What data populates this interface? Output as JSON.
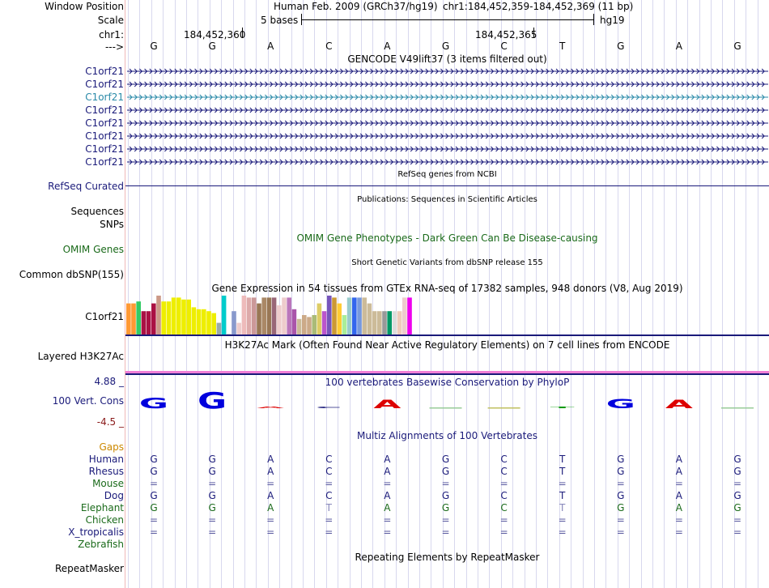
{
  "header": {
    "window_position_label": "Window Position",
    "assembly_text": "Human Feb. 2009 (GRCh37/hg19)",
    "position_text": "chr1:184,452,359-184,452,369 (11 bp)",
    "scale_label": "Scale",
    "scale_text": "5 bases",
    "db": "hg19",
    "chrom_label": "chr1:",
    "coord1": "184,452,360",
    "coord2": "184,452,365",
    "arrow_label": "--->"
  },
  "sequence": [
    "G",
    "G",
    "A",
    "C",
    "A",
    "G",
    "C",
    "T",
    "G",
    "A",
    "G"
  ],
  "gencode": {
    "title": "GENCODE V49lift37 (3 items filtered out)",
    "items": [
      {
        "label": "C1orf21",
        "color": "#1a1a7a"
      },
      {
        "label": "C1orf21",
        "color": "#1a1a7a"
      },
      {
        "label": "C1orf21",
        "color": "#2a8aa8"
      },
      {
        "label": "C1orf21",
        "color": "#1a1a7a"
      },
      {
        "label": "C1orf21",
        "color": "#1a1a7a"
      },
      {
        "label": "C1orf21",
        "color": "#1a1a7a"
      },
      {
        "label": "C1orf21",
        "color": "#1a1a7a"
      },
      {
        "label": "C1orf21",
        "color": "#1a1a7a"
      }
    ]
  },
  "refseq": {
    "center": "RefSeq genes from NCBI",
    "label": "RefSeq Curated"
  },
  "pubs": {
    "center": "Publications: Sequences in Scientific Articles"
  },
  "sequences_label": "Sequences",
  "snps_label": "SNPs",
  "omim": {
    "center": "OMIM Gene Phenotypes - Dark Green Can Be Disease-causing",
    "label": "OMIM Genes"
  },
  "dbsnp": {
    "center": "Short Genetic Variants from dbSNP release 155",
    "label": "Common dbSNP(155)"
  },
  "gtex": {
    "center": "Gene Expression in 54 tissues from GTEx RNA-seq of 17382 samples, 948 donors (V8, Aug 2019)",
    "label": "C1orf21",
    "values": [
      0.8,
      0.8,
      0.85,
      0.6,
      0.6,
      0.8,
      1.0,
      0.85,
      0.85,
      0.95,
      0.95,
      0.9,
      0.9,
      0.7,
      0.65,
      0.65,
      0.6,
      0.55,
      0.3,
      1.0,
      0.0,
      0.6,
      0.3,
      1.0,
      0.95,
      0.95,
      0.8,
      0.95,
      0.95,
      0.95,
      0.75,
      0.95,
      0.95,
      0.65,
      0.4,
      0.5,
      0.45,
      0.5,
      0.8,
      0.6,
      1.0,
      0.95,
      0.8,
      0.5,
      0.95,
      0.95,
      0.95,
      0.95,
      0.8,
      0.6,
      0.6,
      0.6,
      0.6,
      0.6,
      0.6,
      0.95,
      0.95,
      0.2
    ],
    "colors": [
      "#ff9933",
      "#ff9933",
      "#33cc66",
      "#aa1144",
      "#aa1144",
      "#aa1144",
      "#cc9988",
      "#eeee00",
      "#eeee00",
      "#eeee00",
      "#eeee00",
      "#eeee00",
      "#eeee00",
      "#eeee00",
      "#eeee00",
      "#eeee00",
      "#eeee00",
      "#eeee00",
      "#99aaaa",
      "#00cccc",
      "#cccccc",
      "#8899cc",
      "#eecccc",
      "#eebbbb",
      "#ddaaaa",
      "#cc9999",
      "#997755",
      "#aa8866",
      "#997755",
      "#996677",
      "#eecccc",
      "#eecccc",
      "#bb77bb",
      "#aa55aa",
      "#ccbb99",
      "#ccaa88",
      "#ccaa88",
      "#aabb77",
      "#ddcc66",
      "#bb55cc",
      "#7755bb",
      "#cc9933",
      "#ffcc33",
      "#aaee99",
      "#99cccc",
      "#3366ee",
      "#7799dd",
      "#ccbb99",
      "#ccbb99",
      "#ccbb99",
      "#ccbb99",
      "#999999",
      "#009966",
      "#dddddd",
      "#eeccbb",
      "#eecccc",
      "#ee00ee"
    ]
  },
  "h3k27ac": {
    "center": "H3K27Ac Mark (Often Found Near Active Regulatory Elements) on 7 cell lines from ENCODE",
    "label": "Layered H3K27Ac"
  },
  "phylop": {
    "center": "100 vertebrates Basewise Conservation by PhyloP",
    "label": "100 Vert. Cons",
    "max": "4.88 _",
    "min": "-4.5 _",
    "scores": [
      1.4,
      2.2,
      0.2,
      0.1,
      1.1,
      0.0,
      -0.3,
      0.1,
      1.3,
      1.1,
      0.0
    ]
  },
  "multiz": {
    "center": "Multiz Alignments of 100 Vertebrates",
    "gaps_label": "Gaps",
    "species": [
      {
        "name": "Human",
        "color": "#1a1a7a",
        "bases": [
          "G",
          "G",
          "A",
          "C",
          "A",
          "G",
          "C",
          "T",
          "G",
          "A",
          "G"
        ]
      },
      {
        "name": "Rhesus",
        "color": "#1a1a7a",
        "bases": [
          "G",
          "G",
          "A",
          "C",
          "A",
          "G",
          "C",
          "T",
          "G",
          "A",
          "G"
        ]
      },
      {
        "name": "Mouse",
        "color": "#1a6a1a",
        "bases": [
          "=",
          "=",
          "=",
          "=",
          "=",
          "=",
          "=",
          "=",
          "=",
          "=",
          "="
        ]
      },
      {
        "name": "Dog",
        "color": "#1a1a7a",
        "bases": [
          "G",
          "G",
          "A",
          "C",
          "A",
          "G",
          "C",
          "T",
          "G",
          "A",
          "G"
        ]
      },
      {
        "name": "Elephant",
        "color": "#1a6a1a",
        "bases": [
          "G",
          "G",
          "A",
          "T",
          "A",
          "G",
          "C",
          "T",
          "G",
          "A",
          "G"
        ]
      },
      {
        "name": "Chicken",
        "color": "#1a6a1a",
        "bases": [
          "=",
          "=",
          "=",
          "=",
          "=",
          "=",
          "=",
          "=",
          "=",
          "=",
          "="
        ]
      },
      {
        "name": "X_tropicalis",
        "color": "#1a1a7a",
        "bases": [
          "=",
          "=",
          "=",
          "=",
          "=",
          "=",
          "=",
          "=",
          "=",
          "=",
          "="
        ]
      },
      {
        "name": "Zebrafish",
        "color": "#1a6a1a",
        "bases": [
          "",
          "",
          "",
          "",
          "",
          "",
          "",
          "",
          "",
          "",
          ""
        ]
      }
    ]
  },
  "repeatmasker": {
    "center": "Repeating Elements by RepeatMasker",
    "label": "RepeatMasker"
  },
  "colors": {
    "navy": "#1a1a7a",
    "orange": "#cc8800",
    "dkgreen": "#1a6a1a",
    "pink": "#f07ed6"
  }
}
